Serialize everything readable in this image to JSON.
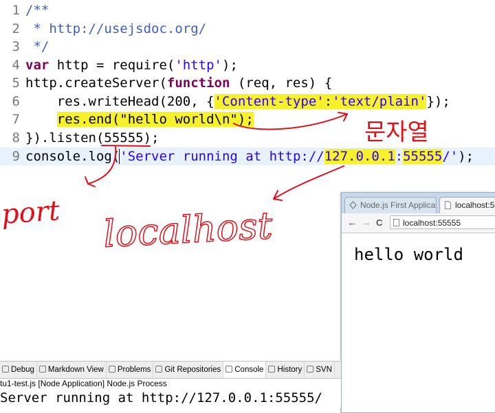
{
  "editor": {
    "line_numbers": [
      "1",
      "2",
      "3",
      "4",
      "5",
      "6",
      "7",
      "8",
      "9"
    ],
    "l1": "/**",
    "l2": " * http://usejsdoc.org/",
    "l3": " */",
    "l4_kw": "var",
    "l4_a": " http = require(",
    "l4_str": "'http'",
    "l4_b": ");",
    "l5_a": "http.createServer(",
    "l5_kw": "function",
    "l5_b": " (req, res) {",
    "l6_a": "    res.writeHead(200, {",
    "l6_str1": "'Content-type'",
    "l6_colon": ":",
    "l6_str2": "'text/plain'",
    "l6_b": "});",
    "l7_indent": "    ",
    "l7_a": "res.end(",
    "l7_str": "\"hello world\\n\"",
    "l7_b": ");",
    "l8_a": "}).listen(",
    "l8_port": "55555",
    "l8_b": ");",
    "l9_a": "console.log(",
    "l9_str1": "'Server running at http://",
    "l9_ip": "127.0.0.1",
    "l9_colon": ":",
    "l9_port": "55555",
    "l9_str2": "/'",
    "l9_b": ");"
  },
  "annotations": {
    "port": "port",
    "localhost": "localhost",
    "string_korean": "문자열"
  },
  "browser": {
    "tab_inactive": "Node.js First Applica",
    "tab_active": "localhost:5",
    "back": "←",
    "forward": "→",
    "reload": "C",
    "url": "localhost:55555",
    "page_text": "hello world"
  },
  "console": {
    "tabs": [
      "Debug",
      "Markdown View",
      "Problems",
      "Git Repositories",
      "Console",
      "History",
      "SVN"
    ],
    "process_label": "tu1-test.js [Node Application] Node.js Process",
    "output": "Server running at http://127.0.0.1:55555/"
  },
  "colors": {
    "keyword": "#7f0055",
    "string": "#2a00ff",
    "comment": "#3f5fbf",
    "highlight": "#f6f12a",
    "ink": "#e0101a"
  }
}
